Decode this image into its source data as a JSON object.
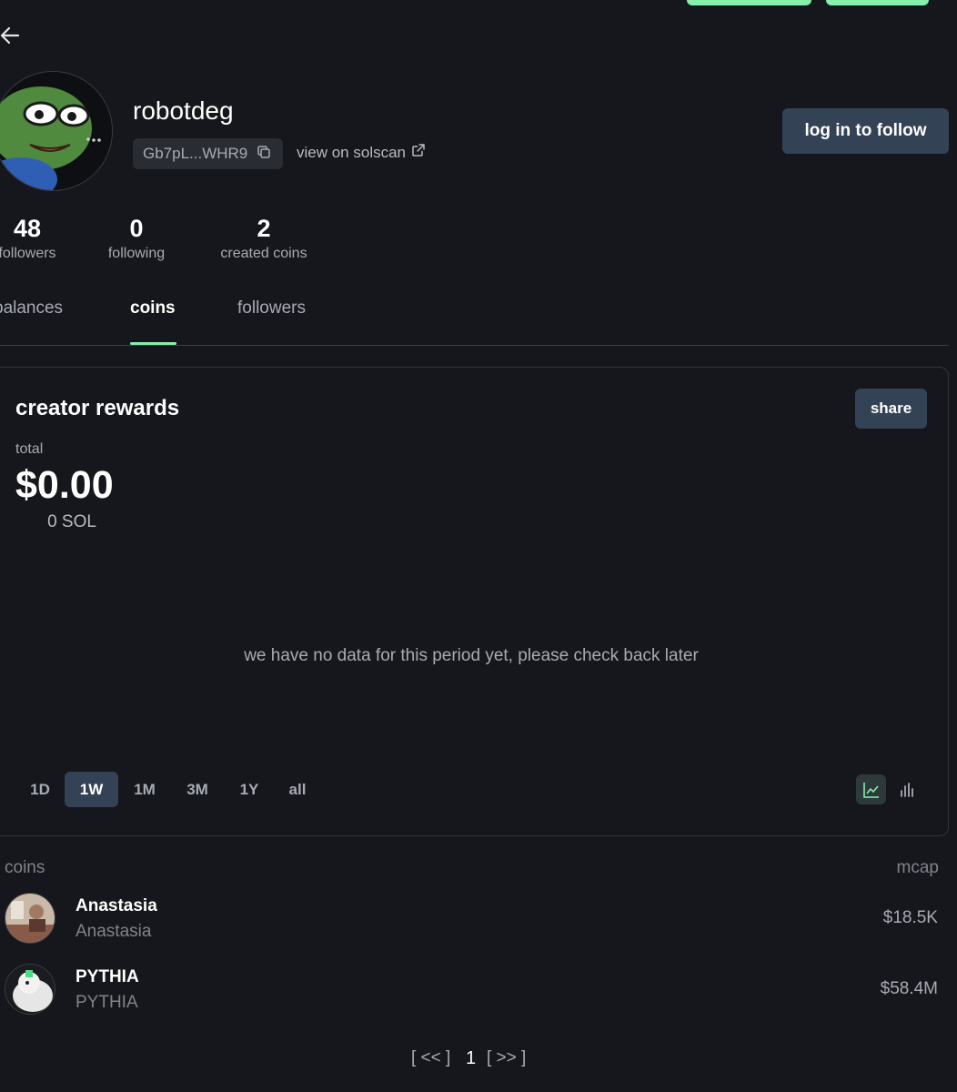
{
  "profile": {
    "username": "robotdeg",
    "address": "Gb7pL...WHR9",
    "solscan_link": "view on solscan",
    "follow_button": "log in to follow"
  },
  "stats": [
    {
      "value": "48",
      "label": "followers"
    },
    {
      "value": "0",
      "label": "following"
    },
    {
      "value": "2",
      "label": "created coins"
    }
  ],
  "tabs": [
    {
      "label": "balances",
      "active": false
    },
    {
      "label": "coins",
      "active": true
    },
    {
      "label": "followers",
      "active": false
    }
  ],
  "rewards": {
    "title": "creator rewards",
    "share_button": "share",
    "total_label": "total",
    "total_usd": "$0.00",
    "total_sol": "0 SOL",
    "empty_message": "we have no data for this period yet, please check back later",
    "periods": [
      "1D",
      "1W",
      "1M",
      "3M",
      "1Y",
      "all"
    ],
    "active_period": "1W",
    "chart_modes": [
      "line-chart-icon",
      "bar-chart-icon"
    ],
    "active_chart_mode": "line-chart-icon"
  },
  "coins_list": {
    "header_left": "coins",
    "header_right": "mcap",
    "items": [
      {
        "name": "Anastasia",
        "symbol": "Anastasia",
        "mcap": "$18.5K"
      },
      {
        "name": "PYTHIA",
        "symbol": "PYTHIA",
        "mcap": "$58.4M"
      }
    ]
  },
  "pagination": {
    "prev": "[ << ]",
    "page": "1",
    "next": "[ >> ]"
  },
  "colors": {
    "background": "#16171c",
    "accent": "#86efac",
    "button": "#344255"
  }
}
